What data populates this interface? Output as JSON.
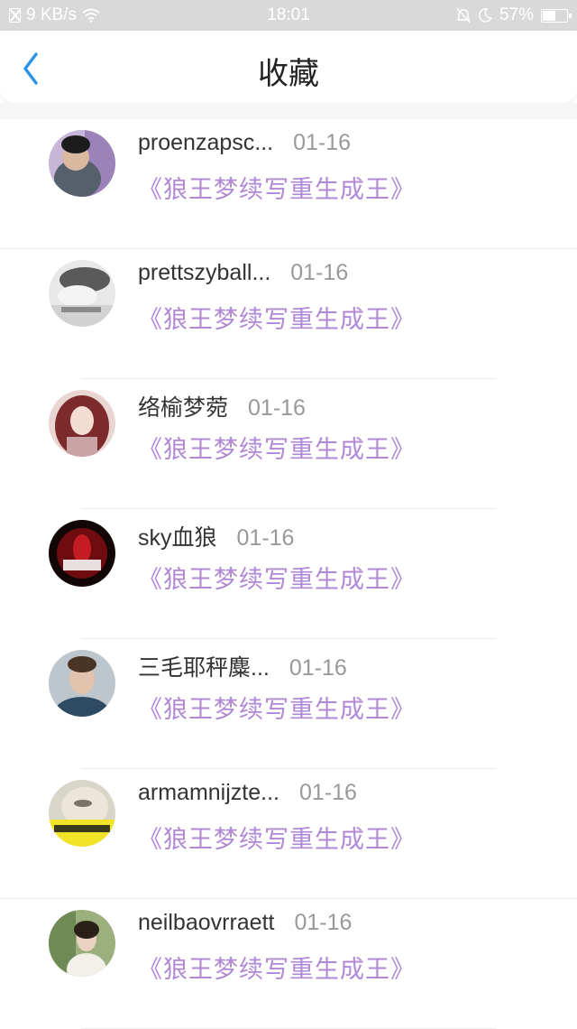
{
  "status_bar": {
    "net_speed": "9 KB/s",
    "time": "18:01",
    "battery": "57%",
    "battery_level": 0.57
  },
  "header": {
    "title": "收藏"
  },
  "items": [
    {
      "name": "proenzapsc...",
      "time": "01-16",
      "book": "《狼王梦续写重生成王》"
    },
    {
      "name": "prettszyball...",
      "time": "01-16",
      "book": "《狼王梦续写重生成王》"
    },
    {
      "name": "络榆梦菀",
      "time": "01-16",
      "book": "《狼王梦续写重生成王》"
    },
    {
      "name": "sky血狼",
      "time": "01-16",
      "book": "《狼王梦续写重生成王》"
    },
    {
      "name": "三毛耶秤麋...",
      "time": "01-16",
      "book": "《狼王梦续写重生成王》"
    },
    {
      "name": "armamnijzte...",
      "time": "01-16",
      "book": "《狼王梦续写重生成王》"
    },
    {
      "name": "neilbaovrraett",
      "time": "01-16",
      "book": "《狼王梦续写重生成王》"
    }
  ]
}
